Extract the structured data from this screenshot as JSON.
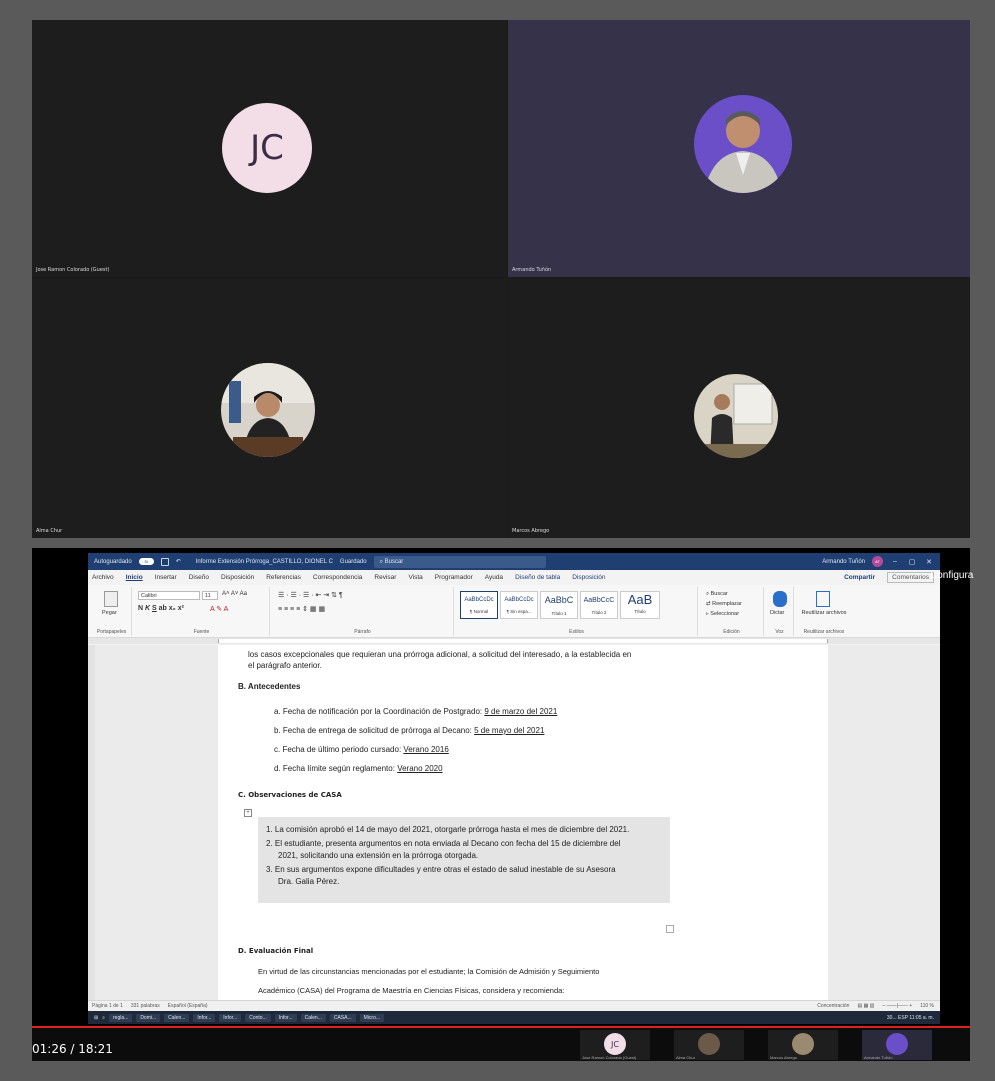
{
  "meeting": {
    "participants": [
      {
        "name": "Jose Ramon Colorado (Guest)",
        "initials": "JC"
      },
      {
        "name": "Armando Tuñón"
      },
      {
        "name": "Alma Chur"
      },
      {
        "name": "Marcos Abrego"
      }
    ]
  },
  "word": {
    "titlebar": {
      "autosave": "Autoguardado",
      "autosave_state": "Sí",
      "doc_title": "Informe Extensión Prórroga_CASTILLO, DIONEL C",
      "saved_state": "Guardado",
      "search_placeholder": "Buscar",
      "user_name": "Armando Tuñón",
      "user_initials": "AT",
      "minimize": "–",
      "restore": "▢",
      "close": "✕"
    },
    "menu": [
      "Archivo",
      "Inicio",
      "Insertar",
      "Diseño",
      "Disposición",
      "Referencias",
      "Correspondencia",
      "Revisar",
      "Vista",
      "Programador",
      "Ayuda",
      "Diseño de tabla",
      "Disposición"
    ],
    "active_menu": "Inicio",
    "share_label": "Compartir",
    "comments_label": "Comentarios",
    "ribbon": {
      "paste_label": "Pegar",
      "clipboard_group": "Portapapeles",
      "font_name": "Calibri",
      "font_size": "11",
      "font_group": "Fuente",
      "paragraph_group": "Párrafo",
      "styles": [
        {
          "preview": "AaBbCcDc",
          "name": "¶ Normal"
        },
        {
          "preview": "AaBbCcDc",
          "name": "¶ Sin espa..."
        },
        {
          "preview": "AaBbC",
          "name": "Título 1"
        },
        {
          "preview": "AaBbCcC",
          "name": "Título 2"
        },
        {
          "preview": "AaB",
          "name": "Título"
        }
      ],
      "styles_group": "Estilos",
      "find": "Buscar",
      "replace": "Reemplazar",
      "select": "Seleccionar",
      "edit_group": "Edición",
      "dictate": "Dictar",
      "voice_group": "Voz",
      "reuse": "Reutilizar archivos",
      "reuse_group": "Reutilizar archivos"
    },
    "document": {
      "intro_line1": "los casos excepcionales que requieran una prórroga adicional, a solicitud del interesado, a la establecida en",
      "intro_line2": "el parágrafo anterior.",
      "section_b": "B.   Antecedentes",
      "items_b": [
        {
          "prefix": "a.   Fecha de notificación por la Coordinación de Postgrado: ",
          "value": "9 de marzo del 2021"
        },
        {
          "prefix": "b.   Fecha de entrega de solicitud de prórroga al Decano: ",
          "value": "5 de mayo del 2021"
        },
        {
          "prefix": "c.   Fecha de último periodo cursado: ",
          "value": "Verano 2016"
        },
        {
          "prefix": "d.   Fecha límite según reglamento: ",
          "value": "Verano 2020"
        }
      ],
      "section_c": "C.   Observaciones de CASA",
      "obs_1": "1.  La comisión aprobó el 14 de mayo del 2021, otorgarle prórroga hasta el mes de diciembre del 2021.",
      "obs_2a": "2.  El estudiante, presenta argumentos en nota enviada al Decano con fecha del 15 de diciembre del",
      "obs_2b": "2021, solicitando una extensión en la prórroga otorgada.",
      "obs_3a": "3.  En sus argumentos expone dificultades y entre otras el estado de salud inestable de su Asesora",
      "obs_3b": "Dra. Galia Pérez.",
      "section_d": "D.   Evaluación Final",
      "final_1": "En virtud de las circunstancias mencionadas por el estudiante; la Comisión de Admisión y Seguimiento",
      "final_2": "Académico (CASA) del Programa de Maestría en Ciencias Físicas, considera y recomienda:"
    },
    "statusbar": {
      "page": "Página 1 de 1",
      "words": "331 palabras",
      "language": "Español (España)",
      "focus": "Concentración",
      "zoom": "110 %"
    }
  },
  "taskbar": {
    "items": [
      "regla...",
      "Domi...",
      "Calen...",
      "Infor...",
      "Infor...",
      "Conto...",
      "Infor...",
      "Calen...",
      "CASA...",
      "Micro..."
    ],
    "weather": "30...",
    "language": "ESP",
    "time": "11:05 a. m."
  },
  "overlay": {
    "configura": "Configura"
  },
  "video": {
    "timecode": "01:26 / 18:21",
    "progress_fraction": 1.0,
    "mini_participants": [
      {
        "name": "Jose Ramon Colorado (Guest)",
        "initials": "JC"
      },
      {
        "name": "Alma Chur"
      },
      {
        "name": "Marcos Abrego"
      },
      {
        "name": "Armando Tuñón"
      }
    ]
  },
  "colors": {
    "word_blue": "#1f3f73",
    "initials_bg": "#f3dde6",
    "tile_purple": "#36324a"
  }
}
